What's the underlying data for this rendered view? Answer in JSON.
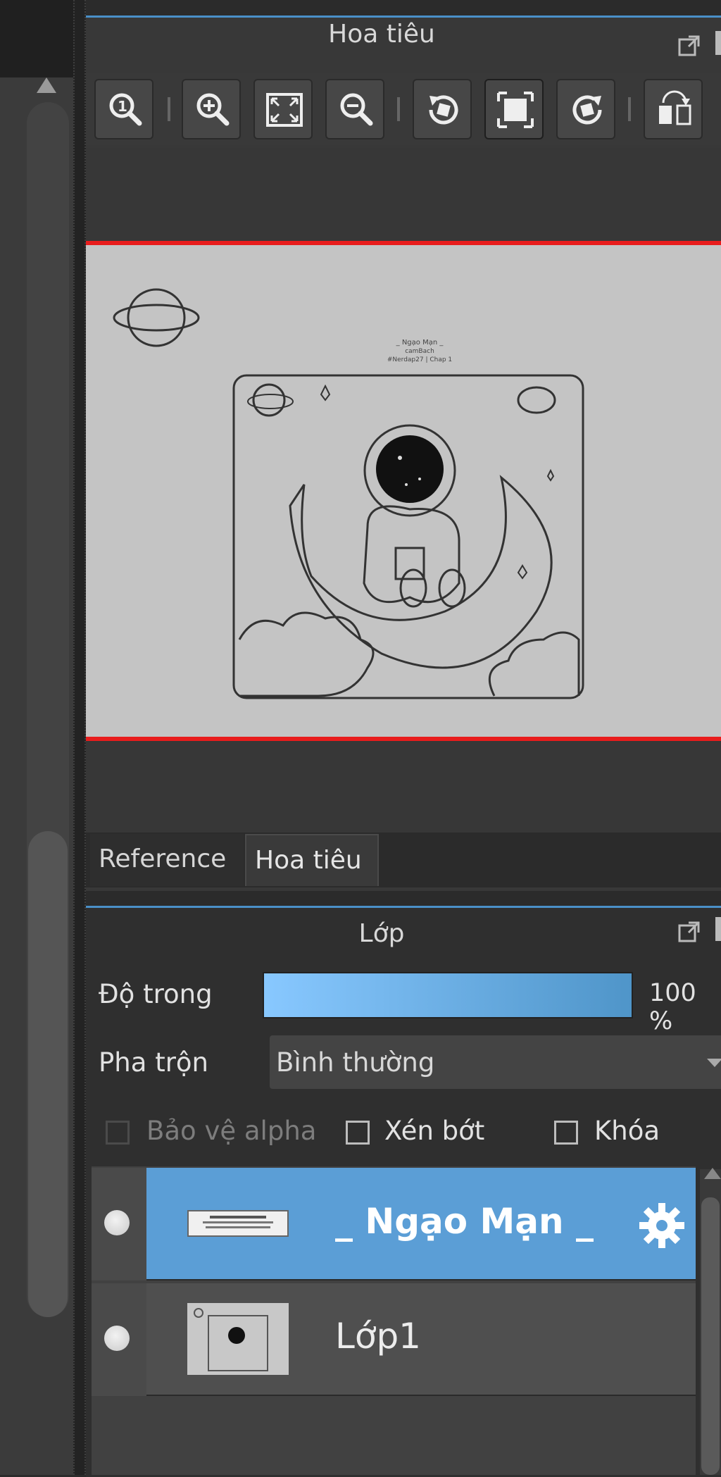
{
  "navigator": {
    "title": "Hoa tiêu",
    "toolbar": [
      {
        "icon": "zoom-actual-icon"
      },
      {
        "icon": "zoom-in-icon"
      },
      {
        "icon": "fit-to-window-icon"
      },
      {
        "icon": "zoom-out-icon"
      },
      {
        "icon": "rotate-left-icon"
      },
      {
        "icon": "fit-frame-icon"
      },
      {
        "icon": "rotate-right-icon"
      },
      {
        "icon": "flip-horizontal-icon"
      }
    ],
    "preview_text": [
      "_ Ngạo Mạn _",
      "camBach",
      "#Nerdap27 | Chap 1"
    ]
  },
  "tabs": [
    {
      "label": "Reference"
    },
    {
      "label": "Hoa tiêu",
      "active": true
    }
  ],
  "layers_panel": {
    "title": "Lớp",
    "opacity_label": "Độ trong",
    "opacity_value": "100 %",
    "opacity_fraction": 1.0,
    "blend_label": "Pha trộn",
    "blend_value": "Bình thường",
    "checkboxes": {
      "protect_alpha": "Bảo vệ alpha",
      "clip": "Xén bớt",
      "lock": "Khóa"
    },
    "layers": [
      {
        "name": "_ Ngạo Mạn _",
        "selected": true
      },
      {
        "name": "Lớp1",
        "selected": false
      }
    ]
  },
  "colors": {
    "accent": "#5b9ed6",
    "frame_border": "#e81c1c",
    "panel_bg": "#383838"
  }
}
